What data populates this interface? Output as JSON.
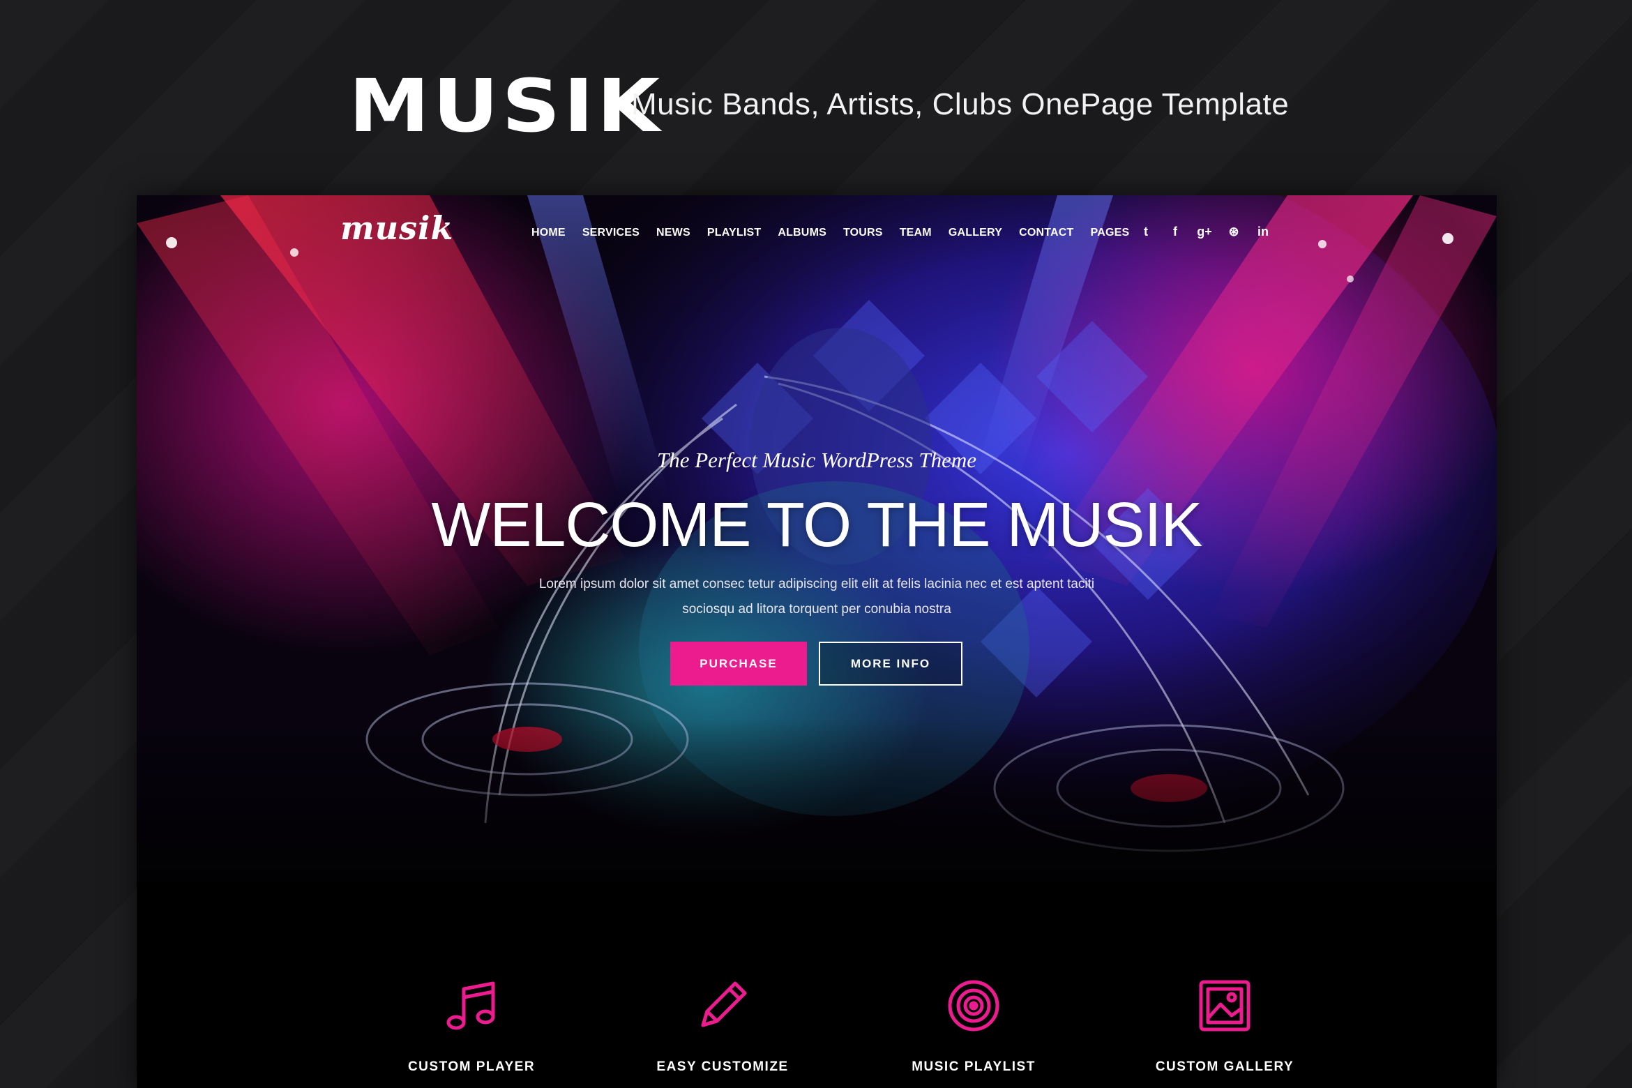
{
  "banner": {
    "logo": "MUSIK",
    "tagline": "Music Bands, Artists, Clubs OnePage Template"
  },
  "site": {
    "logo": "musik",
    "nav": [
      "HOME",
      "SERVICES",
      "NEWS",
      "PLAYLIST",
      "ALBUMS",
      "TOURS",
      "TEAM",
      "GALLERY",
      "CONTACT",
      "PAGES"
    ],
    "social": [
      {
        "name": "twitter-icon",
        "glyph": "t"
      },
      {
        "name": "facebook-icon",
        "glyph": "f"
      },
      {
        "name": "google-plus-icon",
        "glyph": "g+"
      },
      {
        "name": "dribbble-icon",
        "glyph": "⊛"
      },
      {
        "name": "linkedin-icon",
        "glyph": "in"
      }
    ]
  },
  "hero": {
    "subtitle": "The Perfect Music WordPress Theme",
    "title": "WELCOME TO THE MUSIK",
    "body": "Lorem ipsum dolor sit amet consec tetur adipiscing elit elit at felis lacinia nec et est aptent taciti sociosqu ad litora torquent per conubia nostra",
    "purchase_label": "PURCHASE",
    "more_label": "MORE INFO"
  },
  "features": [
    {
      "label": "CUSTOM PLAYER",
      "icon": "music-note-icon"
    },
    {
      "label": "EASY CUSTOMIZE",
      "icon": "pencil-icon"
    },
    {
      "label": "MUSIC PLAYLIST",
      "icon": "vinyl-disc-icon"
    },
    {
      "label": "CUSTOM GALLERY",
      "icon": "image-gallery-icon"
    }
  ],
  "colors": {
    "accent": "#ec1c8f",
    "page_background": "#1a1a1c",
    "hero_blue": "#2a2ad8",
    "hero_red": "#e0163a"
  }
}
